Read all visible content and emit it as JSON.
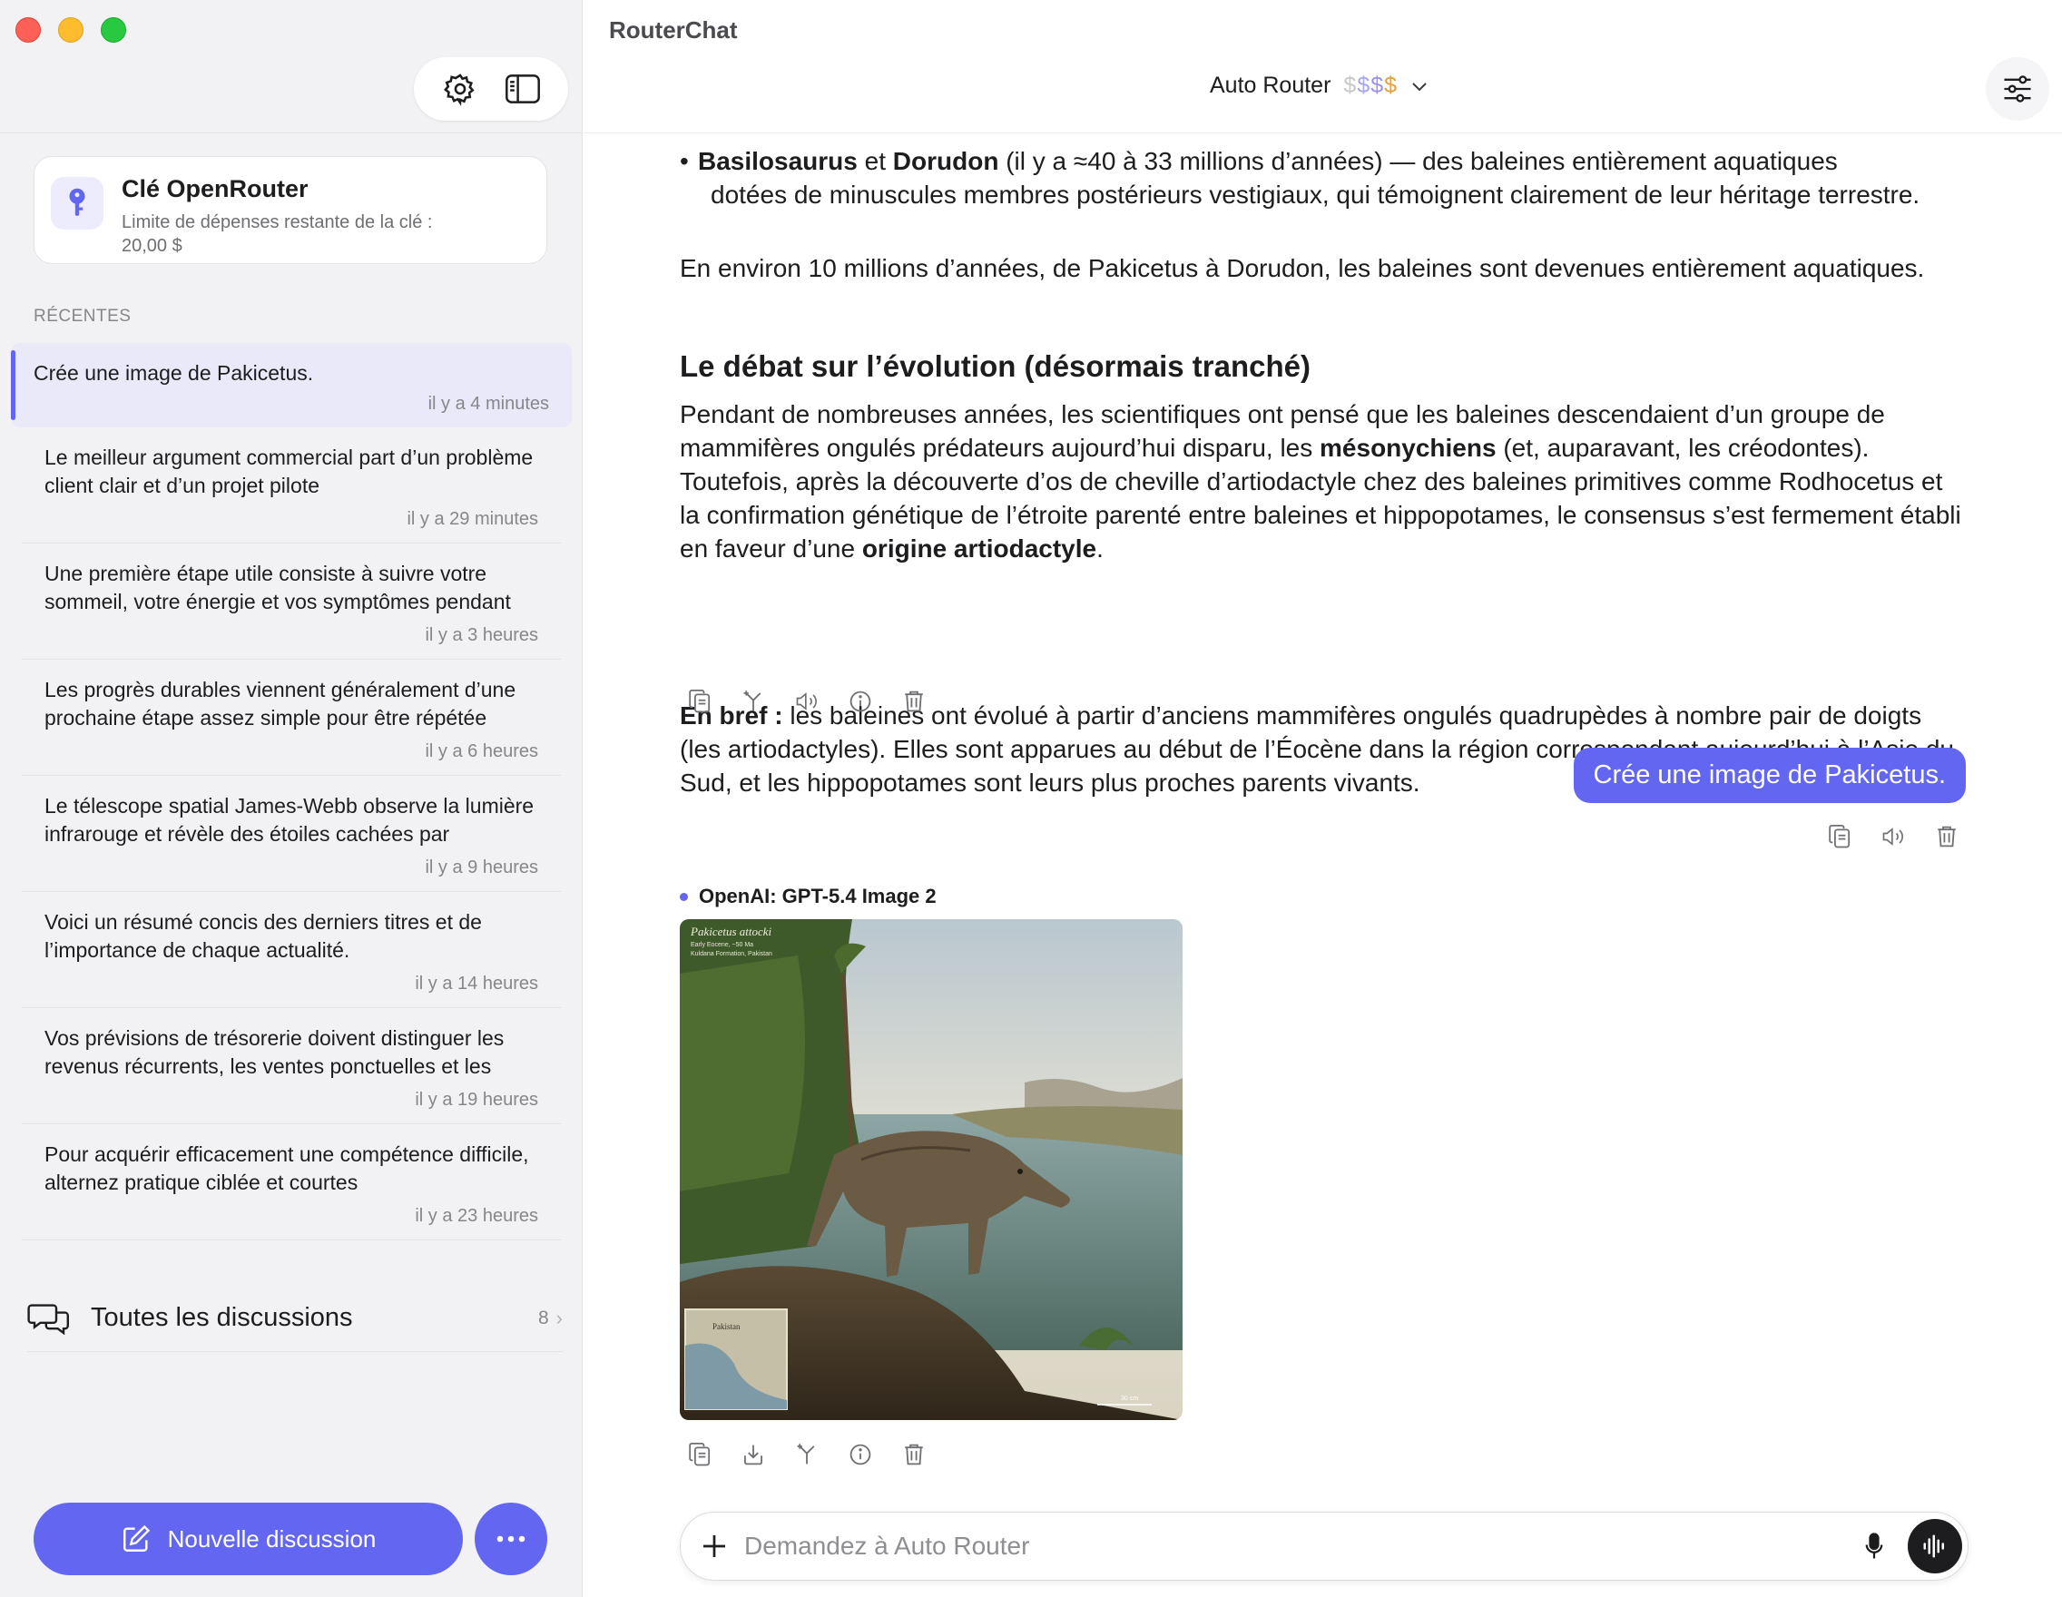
{
  "app": {
    "title": "RouterChat"
  },
  "sidebar": {
    "key_card": {
      "title": "Clé OpenRouter",
      "subtitle": "Limite de dépenses restante de la clé : 20,00 $"
    },
    "recent_label": "RÉCENTES",
    "items": [
      {
        "text": "Crée une image de Pakicetus.",
        "time": "il y a 4 minutes",
        "active": true
      },
      {
        "text": "Le meilleur argument commercial part d’un problème client clair et d’un projet pilote",
        "time": "il y a 29 minutes"
      },
      {
        "text": "Une première étape utile consiste à suivre votre sommeil, votre énergie et vos symptômes pendant",
        "time": "il y a 3 heures"
      },
      {
        "text": "Les progrès durables viennent généralement d’une prochaine étape assez simple pour être répétée",
        "time": "il y a 6 heures"
      },
      {
        "text": "Le télescope spatial James-Webb observe la lumière infrarouge et révèle des étoiles cachées par",
        "time": "il y a 9 heures"
      },
      {
        "text": "Voici un résumé concis des derniers titres et de l’importance de chaque actualité.",
        "time": "il y a 14 heures"
      },
      {
        "text": "Vos prévisions de trésorerie doivent distinguer les revenus récurrents, les ventes ponctuelles et les",
        "time": "il y a 19 heures"
      },
      {
        "text": "Pour acquérir efficacement une compétence difficile, alternez pratique ciblée et courtes",
        "time": "il y a 23 heures"
      }
    ],
    "all_discussions": {
      "label": "Toutes les discussions",
      "count": "8"
    },
    "new_button": "Nouvelle discussion"
  },
  "header": {
    "model_name": "Auto Router",
    "price": [
      "$",
      "$",
      "$",
      "$"
    ]
  },
  "message": {
    "bullet_bold1": "Basilosaurus",
    "bullet_and": " et ",
    "bullet_bold2": "Dorudon",
    "bullet_rest1": " (il y a ≈40 à 33 millions d’années) — des baleines entièrement aquatiques",
    "bullet_rest2": "dotées de minuscules membres postérieurs vestigiaux, qui témoignent clairement de leur héritage terrestre.",
    "para1": "En environ 10 millions d’années, de Pakicetus à Dorudon, les baleines sont devenues entièrement aquatiques.",
    "heading": "Le débat sur l’évolution (désormais tranché)",
    "para2_a": "Pendant de nombreuses années, les scientifiques ont pensé que les baleines descendaient d’un groupe de mammifères ongulés prédateurs aujourd’hui disparu, les ",
    "para2_b": "mésonychiens",
    "para2_c": " (et, auparavant, les créodontes). Toutefois, après la découverte d’os de cheville d’artiodactyle chez des baleines primitives comme Rodhocetus et la confirmation génétique de l’étroite parenté entre baleines et hippopotames, le consensus s’est fermement établi en faveur d’une ",
    "para2_d": "origine artiodactyle",
    "para2_e": ".",
    "para3_bold": "En bref :",
    "para3_rest": " les baleines ont évolué à partir d’anciens mammifères ongulés quadrupèdes à nombre pair de doigts (les artiodactyles). Elles sont apparues au début de l’Éocène dans la région correspondant aujourd’hui à l’Asie du Sud, et les hippopotames sont leurs plus proches parents vivants."
  },
  "user_message": "Crée une image de Pakicetus.",
  "image_reply": {
    "model": "OpenAI: GPT-5.4 Image 2",
    "image_caption_title": "Pakicetus attocki",
    "image_caption_line1": "Early Eocene, ~50 Ma",
    "image_caption_line2": "Kuldana Formation, Pakistan",
    "map_label": "Pakistan",
    "scale_label": "30 cm"
  },
  "composer": {
    "placeholder": "Demandez à Auto Router"
  },
  "colors": {
    "accent": "#6366f1",
    "sidebar_bg": "#f2f2f4"
  }
}
